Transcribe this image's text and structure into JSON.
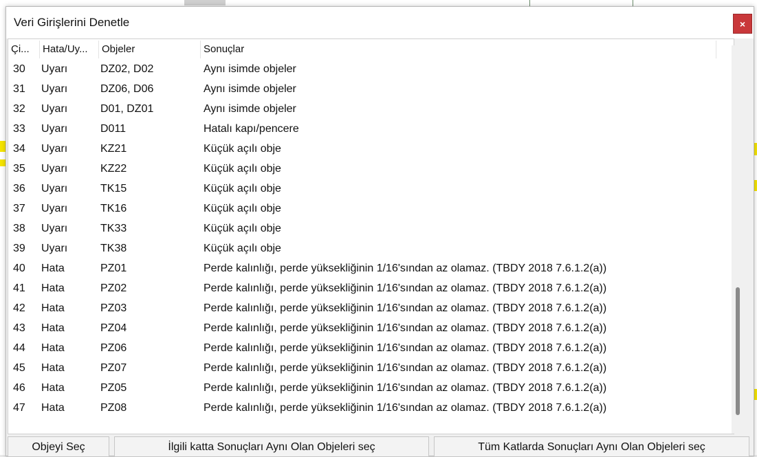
{
  "dialog": {
    "title": "Veri Girişlerini Denetle",
    "close_label": "×"
  },
  "columns": [
    "Çi...",
    "Hata/Uy...",
    "Objeler",
    "Sonuçlar"
  ],
  "rows": [
    {
      "no": "30",
      "type": "Uyarı",
      "objects": "DZ02, D02",
      "result": "Aynı isimde objeler"
    },
    {
      "no": "31",
      "type": "Uyarı",
      "objects": "DZ06, D06",
      "result": "Aynı isimde objeler"
    },
    {
      "no": "32",
      "type": "Uyarı",
      "objects": "D01, DZ01",
      "result": "Aynı isimde objeler"
    },
    {
      "no": "33",
      "type": "Uyarı",
      "objects": "D011",
      "result": "Hatalı kapı/pencere"
    },
    {
      "no": "34",
      "type": "Uyarı",
      "objects": "KZ21",
      "result": "Küçük açılı obje"
    },
    {
      "no": "35",
      "type": "Uyarı",
      "objects": "KZ22",
      "result": "Küçük açılı obje"
    },
    {
      "no": "36",
      "type": "Uyarı",
      "objects": "TK15",
      "result": "Küçük açılı obje"
    },
    {
      "no": "37",
      "type": "Uyarı",
      "objects": "TK16",
      "result": "Küçük açılı obje"
    },
    {
      "no": "38",
      "type": "Uyarı",
      "objects": "TK33",
      "result": "Küçük açılı obje"
    },
    {
      "no": "39",
      "type": "Uyarı",
      "objects": "TK38",
      "result": "Küçük açılı obje"
    },
    {
      "no": "40",
      "type": "Hata",
      "objects": "PZ01",
      "result": "Perde kalınlığı, perde yüksekliğinin 1/16'sından az olamaz. (TBDY 2018 7.6.1.2(a))"
    },
    {
      "no": "41",
      "type": "Hata",
      "objects": "PZ02",
      "result": "Perde kalınlığı, perde yüksekliğinin 1/16'sından az olamaz. (TBDY 2018 7.6.1.2(a))"
    },
    {
      "no": "42",
      "type": "Hata",
      "objects": "PZ03",
      "result": "Perde kalınlığı, perde yüksekliğinin 1/16'sından az olamaz. (TBDY 2018 7.6.1.2(a))"
    },
    {
      "no": "43",
      "type": "Hata",
      "objects": "PZ04",
      "result": "Perde kalınlığı, perde yüksekliğinin 1/16'sından az olamaz. (TBDY 2018 7.6.1.2(a))"
    },
    {
      "no": "44",
      "type": "Hata",
      "objects": "PZ06",
      "result": "Perde kalınlığı, perde yüksekliğinin 1/16'sından az olamaz. (TBDY 2018 7.6.1.2(a))"
    },
    {
      "no": "45",
      "type": "Hata",
      "objects": "PZ07",
      "result": "Perde kalınlığı, perde yüksekliğinin 1/16'sından az olamaz. (TBDY 2018 7.6.1.2(a))"
    },
    {
      "no": "46",
      "type": "Hata",
      "objects": "PZ05",
      "result": "Perde kalınlığı, perde yüksekliğinin 1/16'sından az olamaz. (TBDY 2018 7.6.1.2(a))"
    },
    {
      "no": "47",
      "type": "Hata",
      "objects": "PZ08",
      "result": "Perde kalınlığı, perde yüksekliğinin 1/16'sından az olamaz. (TBDY 2018 7.6.1.2(a))"
    }
  ],
  "buttons": {
    "select_object": "Objeyi Seç",
    "select_same_floor": "İlgili katta Sonuçları Aynı Olan Objeleri seç",
    "select_all_floors": "Tüm Katlarda Sonuçları Aynı Olan Objeleri seç"
  },
  "colors": {
    "close_button": "#c9383a",
    "background_highlight": "#f5e400"
  }
}
